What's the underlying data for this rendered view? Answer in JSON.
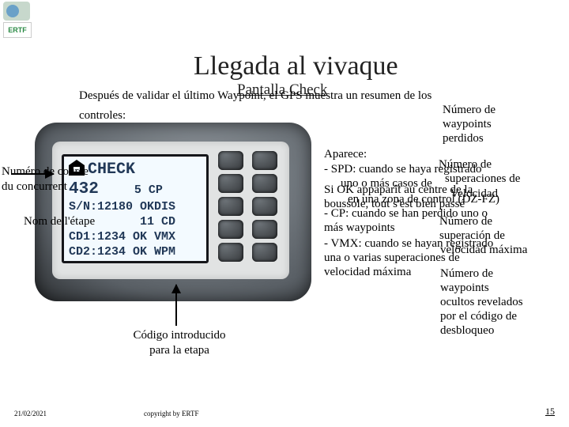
{
  "logo_text": "ERTF",
  "title": "Llegada al vivaque",
  "subtitle": "Pantalla Check",
  "description_line1": "Después de validar el último Waypoint, el GPS muestra un resumen de los",
  "description_line2": "controles:",
  "screen": {
    "header_word": "CHECK",
    "row_big": "432",
    "col2_r1": "5 CP",
    "row_sn": "S/N:12180",
    "col2_r2": "OKDIS",
    "col2_r3": "11 CD",
    "row_cd1": "CD1:1234",
    "col2_r4": "OK VMX",
    "row_cd2": "CD2:1234",
    "col2_r5": "OK WPM"
  },
  "left_annot1": "Numéro de course\n du concurrent",
  "left_annot2": "Nom de l'étape",
  "bottom_annot": "Código introducido\npara la etapa",
  "right": {
    "l1": "Número de",
    "l2": "waypoints",
    "l3": "perdidos",
    "l4": "Aparece:",
    "l5": "Número de",
    "l6": "-  SPD: cuando se haya registrado",
    "l7_a": "uno o más casos de",
    "l7_b": "superaciones de",
    "l8_a": "Si OK appaparît au centre de la",
    "l8_b": "Velocidad",
    "l9_a": "boussole, tout s'est bien passé",
    "l9_b": "en una zona de control (DZ-FZ)",
    "l10": "- CP: cuando se han perdido uno o",
    "l11_a": "más waypoints",
    "l11_b": "Número de",
    "l12": "superación de",
    "l13_a": "- VMX: cuando se hayan registrado",
    "l13_b": "velocidad máxima",
    "l14": "una o varias superaciones de",
    "l15": "velocidad máxima",
    "l16": "Número de",
    "l17": "waypoints",
    "l18": "ocultos revelados",
    "l19": "por el código de",
    "l20": "desbloqueo"
  },
  "footer": {
    "date": "21/02/2021",
    "center": "copyright by ERTF",
    "page": "15"
  }
}
